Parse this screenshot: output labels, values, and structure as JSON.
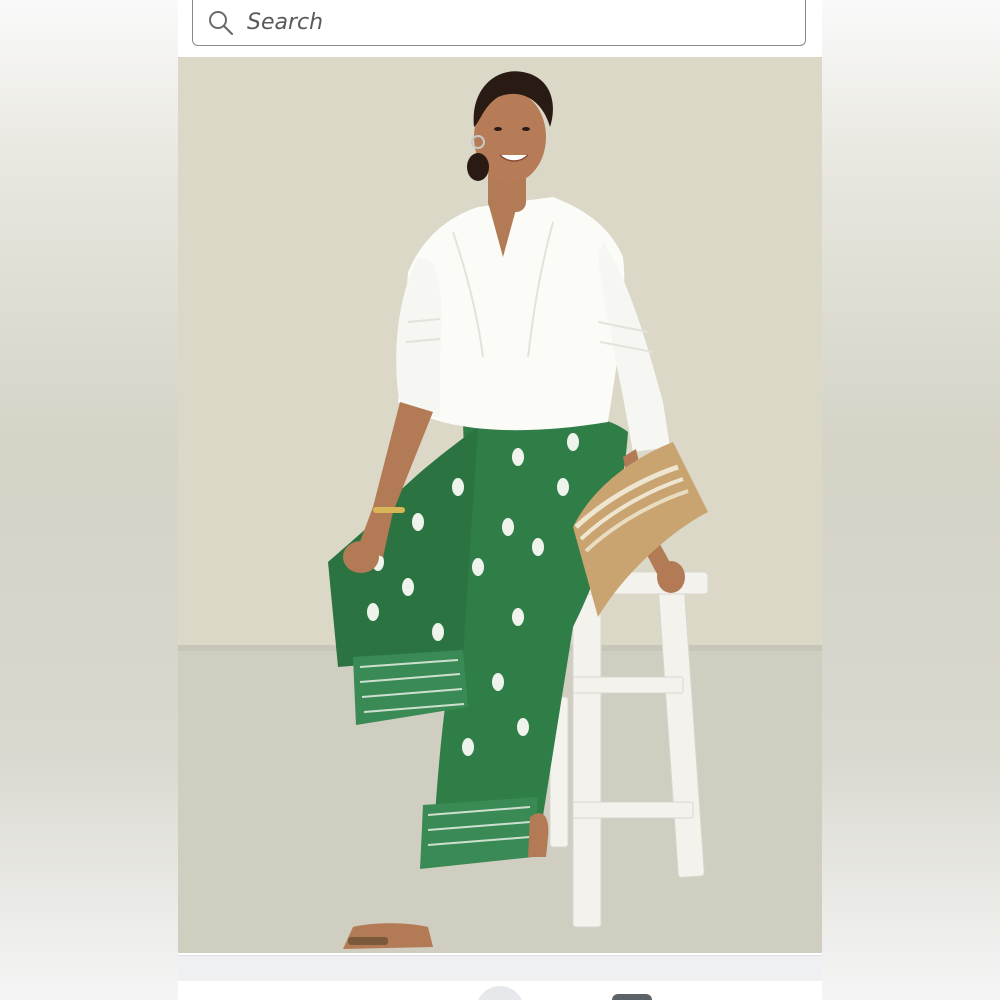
{
  "search": {
    "placeholder": "Search",
    "icon": "search-icon"
  },
  "listing": {
    "photo_subject": "product-photo",
    "colors": {
      "backdrop": "#d9d6c5",
      "floor": "#cfcdbf",
      "pants": "#2e7d46",
      "blouse": "#fbfbf8",
      "stool": "#f1f0ea",
      "clutch": "#c9a470"
    }
  },
  "bottom_bar": {
    "icons": [
      "nav-button-icon",
      "tab-icon"
    ]
  }
}
